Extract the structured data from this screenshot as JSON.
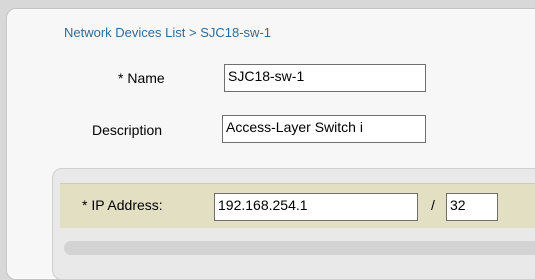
{
  "breadcrumb": {
    "parent": "Network Devices List",
    "separator": " > ",
    "current": "SJC18-sw-1"
  },
  "form": {
    "name_label": "* Name",
    "name_value": "SJC18-sw-1",
    "description_label": "Description",
    "description_value": "Access-Layer Switch i",
    "ip_label": "* IP Address:",
    "ip_value": "192.168.254.1",
    "slash": "/",
    "mask_value": "32"
  },
  "colors": {
    "link": "#2e6c99",
    "ip_bar": "#e2dfc3"
  }
}
